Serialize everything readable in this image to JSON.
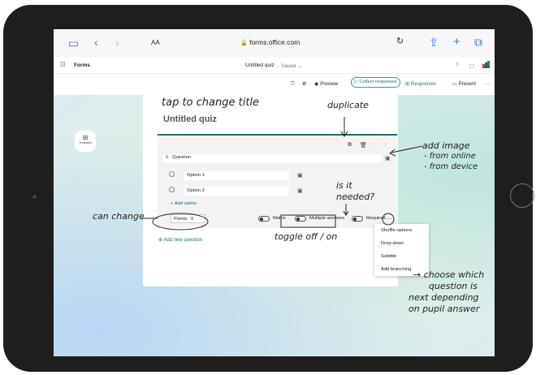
{
  "browser": {
    "text_size": "AA",
    "url": "forms.office.com"
  },
  "app": {
    "name": "Forms",
    "doc_title": "Untitled quiz",
    "saved": "Saved",
    "help": "?"
  },
  "toolbar": {
    "preview": "Preview",
    "collect": "Collect responses",
    "responses": "Responses",
    "present": "Present",
    "more": "···"
  },
  "sidebar": {
    "templates": "Templates"
  },
  "quiz": {
    "title": "Untitled quiz",
    "question_number": "1.",
    "question": "Question",
    "options": [
      "Option 1",
      "Option 2"
    ],
    "add_option": "Add option",
    "points_label": "Points:",
    "points_value": "0",
    "maths": "Maths",
    "multiple_answers": "Multiple answers",
    "required": "Required",
    "add_new_question": "Add new question"
  },
  "menu": {
    "items": [
      "Shuffle options",
      "Drop-down",
      "Subtitle",
      "Add branching"
    ]
  },
  "annotations": {
    "tap_title": "tap to change title",
    "duplicate": "duplicate",
    "add_image": "add image",
    "from_online": "- from online",
    "from_device": "- from device",
    "is_it_needed_1": "is it",
    "is_it_needed_2": "needed?",
    "can_change": "can change",
    "toggle": "toggle off / on",
    "choose_1": "→ choose which",
    "choose_2": "question is",
    "choose_3": "next depending",
    "choose_4": "on pupil answer"
  }
}
